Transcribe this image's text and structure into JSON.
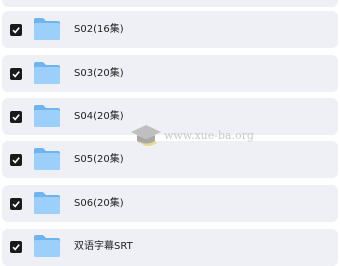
{
  "folders": [
    {
      "name": "S02(16集)",
      "checked": true
    },
    {
      "name": "S03(20集)",
      "checked": true
    },
    {
      "name": "S04(20集)",
      "checked": true
    },
    {
      "name": "S05(20集)",
      "checked": true
    },
    {
      "name": "S06(20集)",
      "checked": true
    },
    {
      "name": "双语字幕SRT",
      "checked": true
    }
  ],
  "watermark": {
    "text": "www.xue-ba.org"
  },
  "colors": {
    "row_bg": "#eef0f5",
    "checkbox": "#1a1a1a",
    "folder_back": "#6fb4ee",
    "folder_front": "#9cd0fb"
  }
}
